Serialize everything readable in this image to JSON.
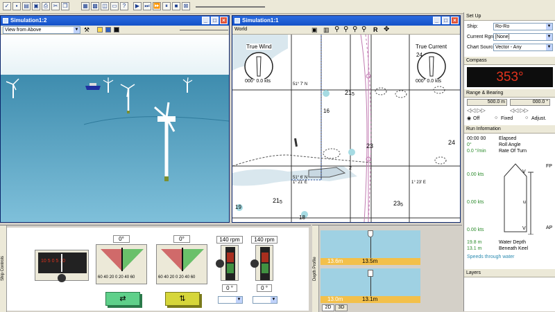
{
  "sim_3d": {
    "title": "Simulation1:2",
    "view": "View from Above"
  },
  "sim_chart": {
    "title": "Simulation1:1",
    "world_label": "World",
    "toolbar_r": "R",
    "true_wind": {
      "label": "True Wind",
      "value": "000° 0.0 kts"
    },
    "true_current": {
      "label": "True Current",
      "value": "000° 0.0 kts"
    },
    "soundings": [
      "21",
      "5",
      "23",
      "21",
      "5",
      "23",
      "5",
      "24",
      "19",
      "2",
      "16",
      "18",
      "24",
      "6",
      "1",
      "19",
      "7"
    ],
    "lat_labels": [
      "51° 7' N",
      "51° 6' N",
      "1° 21' E",
      "1° 23' E"
    ]
  },
  "setup": {
    "heading": "Set Up",
    "ship_label": "Ship:",
    "ship_value": "Ro-Ro",
    "rgn_label": "Current Rgn:",
    "rgn_value": "[None]",
    "source_label": "Chart Source:",
    "source_value": "Vector - Any"
  },
  "compass": {
    "heading": "Compass",
    "value": "353°"
  },
  "range_bearing": {
    "heading": "Range & Bearing",
    "range": "500.0 m",
    "bearing": "000.0 °",
    "off": "Off",
    "fixed": "Fixed",
    "adjust": "Adjust."
  },
  "run_info": {
    "heading": "Run Information",
    "time": "00:00 00",
    "time_label": "Elapsed",
    "roll": "0°",
    "roll_label": "Roll Angle",
    "turn": "0.0 °/min",
    "turn_label": "Rate Of Turn",
    "speeds": [
      "0.00 kts",
      "0.00 kts",
      "0.00 kts"
    ],
    "v_label": "V",
    "u_label": "u",
    "fp_label": "FP",
    "ap_label": "AP",
    "depth": "19.8 m",
    "depth_label": "Water Depth",
    "keel": "13.1 m",
    "keel_label": "Beneath Keel",
    "speeds_title": "Speeds through water"
  },
  "layers": {
    "heading": "Layers"
  },
  "ship_controls": {
    "title": "Ship Controls",
    "rudder1_value": "0°",
    "rudder2_value": "0°",
    "rpm1": "140 rpm",
    "rpm2": "140 rpm",
    "deg1": "0 °",
    "deg2": "0 °",
    "scale_labels": "60 40 20 0 20 40 60",
    "bow_scale": "10 5 0 5 10"
  },
  "depth_profile": {
    "title": "Depth Profile",
    "top": {
      "left": "13.6m",
      "center": "13.5m"
    },
    "bottom": {
      "left": "13.0m",
      "center": "13.1m"
    },
    "tab_2d": "2D",
    "tab_3d": "3D"
  }
}
